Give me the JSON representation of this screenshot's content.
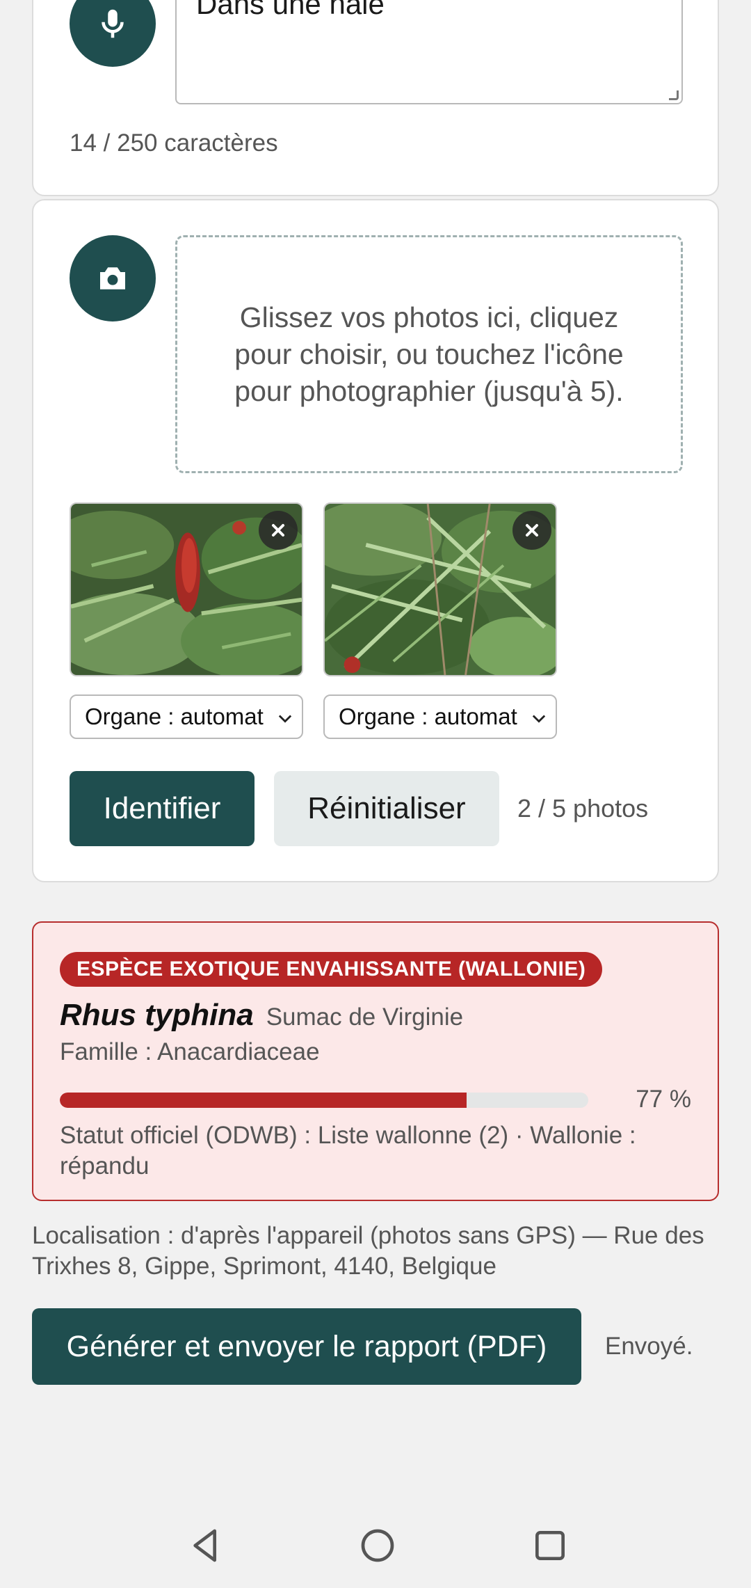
{
  "voice": {
    "mic_icon": "microphone-icon",
    "text_value": "Dans une haie",
    "char_count": "14 / 250 caractères"
  },
  "photos": {
    "camera_icon": "camera-icon",
    "dropzone_text": "Glissez vos photos ici, cliquez pour choisir, ou touchez l'icône pour photographier (jusqu'à 5).",
    "items": [
      {
        "organ_label": "Organe : automat"
      },
      {
        "organ_label": "Organe : automat"
      }
    ],
    "identify_label": "Identifier",
    "reset_label": "Réinitialiser",
    "count": "2 / 5 photos"
  },
  "result": {
    "badge": "ESPÈCE EXOTIQUE ENVAHISSANTE (WALLONIE)",
    "scientific_name": "Rhus typhina",
    "common_name": "Sumac de Virginie",
    "family": "Famille : Anacardiaceae",
    "confidence": 77,
    "confidence_label": "77 %",
    "status": "Statut officiel (ODWB) : Liste wallonne (2) · Wallonie : répandu",
    "accent_color": "#b72626"
  },
  "location": "Localisation : d'après l'appareil (photos sans GPS) — Rue des Trixhes 8, Gippe, Sprimont, 4140, Belgique",
  "report": {
    "button_label": "Générer et envoyer le rapport (PDF)",
    "status": "Envoyé."
  },
  "colors": {
    "primary": "#1f4e4f",
    "secondary_bg": "#e6ebeb",
    "alert_bg": "#fce8e8"
  }
}
